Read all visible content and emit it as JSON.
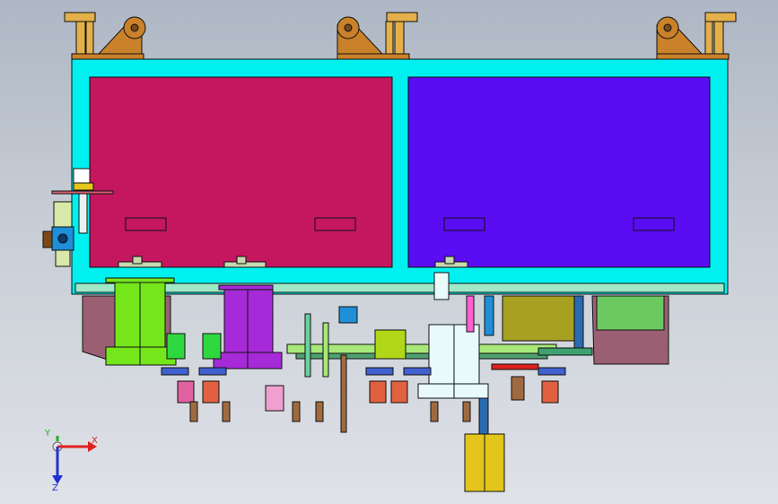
{
  "viewport": {
    "background_top": "#aeb7c4",
    "background_bottom": "#dfe2e7"
  },
  "colors": {
    "frame": "#00f0f0",
    "left_panel": "#c4175f",
    "right_panel": "#5a0cf2",
    "bracket": "#c9812a",
    "roller": "#e3b04a",
    "green_part": "#74e61a",
    "purple_part": "#a62ad8",
    "white_part": "#e8fafa",
    "yellow_part": "#e3c51c",
    "olive_block": "#a8a020",
    "green_block": "#6cc860",
    "lower_plate": "#9a5f72"
  },
  "triad": {
    "x_label": "X",
    "y_label": "Y",
    "z_label": "Z",
    "x_color": "#e02020",
    "y_color": "#20b020",
    "z_color": "#2030d0"
  }
}
